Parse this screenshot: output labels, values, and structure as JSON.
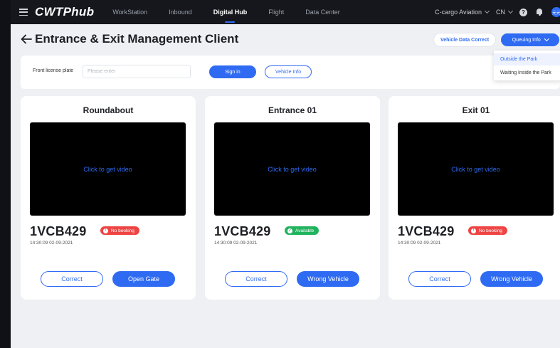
{
  "app": {
    "logo": "CWTPhub",
    "avatar_text": "元元"
  },
  "nav": [
    "WorkStation",
    "Inbound",
    "Digital Hub",
    "Flight",
    "Data Center"
  ],
  "nav_active_index": 2,
  "top_right": {
    "company": "C-cargo Aviation",
    "language": "CN",
    "help_icon": "?"
  },
  "page": {
    "title": "Entrance & Exit Management Client",
    "vehicle_data_correct": "Vehicle Data Correct",
    "queuing_info": "Queuing Info"
  },
  "dropdown": {
    "options": [
      "Outside the Park",
      "Waiting Inside the Park"
    ],
    "selected_index": 0
  },
  "search": {
    "label": "Front license plate",
    "placeholder": "Please enter",
    "sign_in": "Sign in",
    "vehicle_info": "Vehicle Info"
  },
  "cards": [
    {
      "title": "Roundabout",
      "video_text": "Click to get video",
      "plate": "1VCB429",
      "status": "No booking",
      "status_color": "#ef4444",
      "status_icon": "!",
      "time": "14:30:09  02-09-2021",
      "btn_left": "Correct",
      "btn_right": "Open Gate"
    },
    {
      "title": "Entrance 01",
      "video_text": "Click to get video",
      "plate": "1VCB429",
      "status": "Available",
      "status_color": "#22b35e",
      "status_icon": "✓",
      "time": "14:30:09  02-09-2021",
      "btn_left": "Correct",
      "btn_right": "Wrong Vehicle"
    },
    {
      "title": "Exit 01",
      "video_text": "Click to get video",
      "plate": "1VCB429",
      "status": "No booking",
      "status_color": "#ef4444",
      "status_icon": "!",
      "time": "14:30:09  02-09-2021",
      "btn_left": "Correct",
      "btn_right": "Wrong Vehicle"
    }
  ],
  "colors": {
    "accent": "#2f6bf2",
    "topbar": "#15171c",
    "background": "#eef0f4"
  }
}
